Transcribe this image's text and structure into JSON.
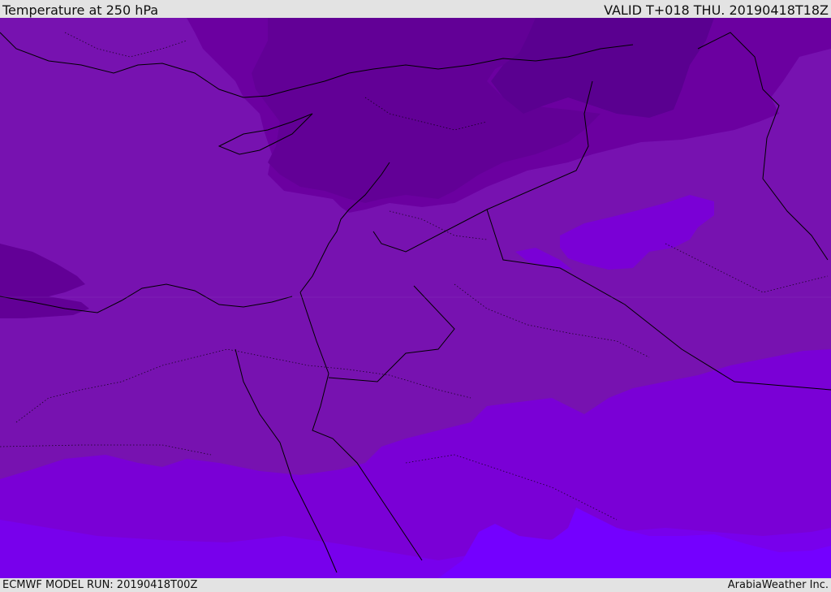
{
  "header": {
    "title": "Temperature at 250 hPa",
    "valid_time": "VALID T+018 THU. 20190418T18Z"
  },
  "footer": {
    "model_run": "ECMWF MODEL RUN: 20190418T00Z",
    "credit": "ArabiaWeather Inc."
  },
  "map": {
    "field": "temperature",
    "colors": {
      "coldest": "#5a0090",
      "colder": "#620096",
      "cold": "#6b00a0",
      "base": "#7712b0",
      "warm": "#7a00d6",
      "warmer": "#7800ec",
      "warmest": "#7400ff",
      "border": "#000000"
    }
  }
}
